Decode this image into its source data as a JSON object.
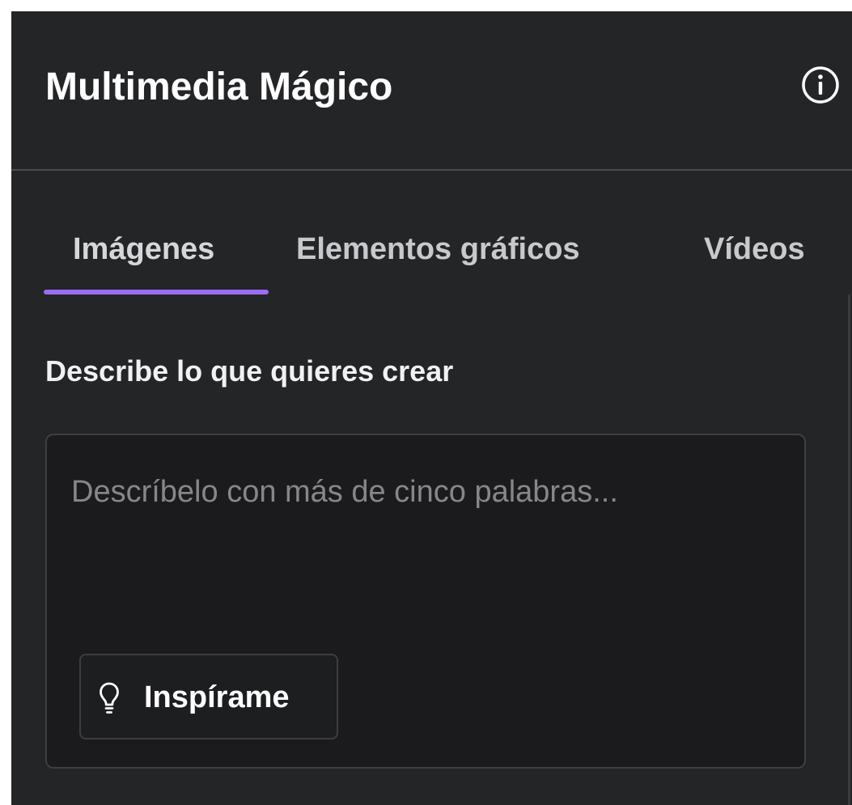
{
  "panel": {
    "title": "Multimedia Mágico",
    "info_icon": "info-icon"
  },
  "tabs": [
    {
      "label": "Imágenes",
      "active": true
    },
    {
      "label": "Elementos gráficos",
      "active": false
    },
    {
      "label": "Vídeos",
      "active": false
    }
  ],
  "prompt": {
    "label": "Describe lo que quieres crear",
    "value": "",
    "placeholder": "Descríbelo con más de cinco palabras..."
  },
  "inspire_button": {
    "label": "Inspírame",
    "icon": "lightbulb-icon"
  },
  "colors": {
    "panel_bg": "#242527",
    "input_bg": "#1b1b1d",
    "accent": "#9b6cf7"
  }
}
